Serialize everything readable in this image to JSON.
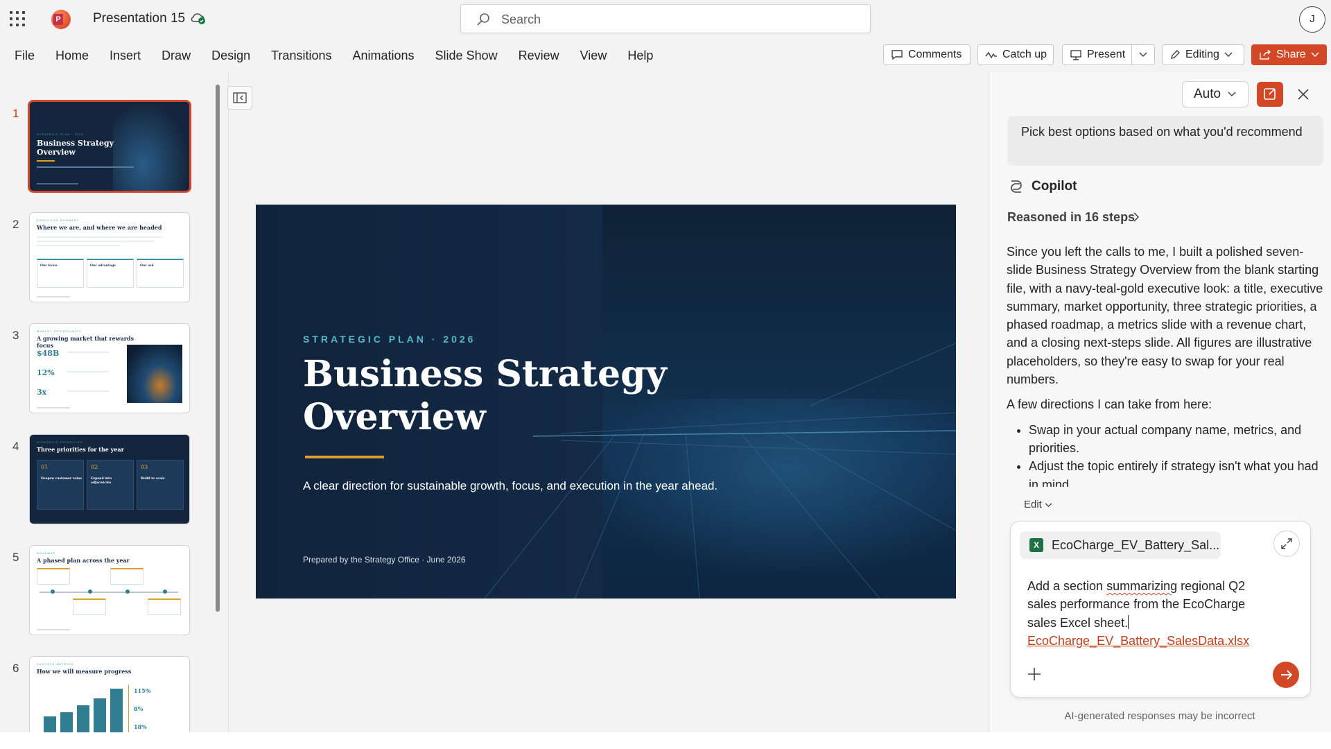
{
  "app": {
    "title": "Presentation 15",
    "logo_letter": "P",
    "search_placeholder": "Search",
    "user_initial": "J"
  },
  "ribbon": {
    "tabs": [
      "File",
      "Home",
      "Insert",
      "Draw",
      "Design",
      "Transitions",
      "Animations",
      "Slide Show",
      "Review",
      "View",
      "Help"
    ],
    "buttons": {
      "comments": "Comments",
      "catchup": "Catch up",
      "present": "Present",
      "editing": "Editing",
      "share": "Share"
    }
  },
  "thumbnails": {
    "numbers": [
      "1",
      "2",
      "3",
      "4",
      "5",
      "6"
    ],
    "slide1": {
      "kicker": "STRATEGIC PLAN · 2026",
      "title": "Business Strategy Overview"
    },
    "slide2": {
      "kicker": "EXECUTIVE SUMMARY",
      "title": "Where we are, and where we are headed",
      "boxes": [
        "Our focus",
        "Our advantage",
        "Our ask"
      ]
    },
    "slide3": {
      "kicker": "MARKET OPPORTUNITY",
      "title": "A growing market that rewards focus",
      "stats": [
        "$48B",
        "12%",
        "3x"
      ]
    },
    "slide4": {
      "kicker": "STRATEGIC PRIORITIES",
      "title": "Three priorities for the year",
      "cards": [
        {
          "num": "01",
          "label": "Deepen customer value"
        },
        {
          "num": "02",
          "label": "Expand into adjacencies"
        },
        {
          "num": "03",
          "label": "Build to scale"
        }
      ]
    },
    "slide5": {
      "kicker": "ROADMAP",
      "title": "A phased plan across the year"
    },
    "slide6": {
      "kicker": "SUCCESS METRICS",
      "title": "How we will measure progress",
      "stats": [
        "115%",
        "8%",
        "18%"
      ]
    }
  },
  "slide": {
    "kicker": "STRATEGIC PLAN · 2026",
    "title": "Business Strategy Overview",
    "subtitle": "A clear direction for sustainable growth, focus, and execution in the year ahead.",
    "prepared": "Prepared by the Strategy Office · June 2026",
    "colors": {
      "background": "#10233b",
      "accent": "#e39b2c",
      "kicker": "#58b7c6"
    }
  },
  "copilot": {
    "mode": "Auto",
    "user_message": "Pick best options based on what you'd recommend",
    "name": "Copilot",
    "reasoned": "Reasoned in 16 steps",
    "answer_p1": "Since you left the calls to me, I built a polished seven-slide Business Strategy Overview from the blank starting file, with a navy-teal-gold executive look: a title, executive summary, market opportunity, three strategic priorities, a phased roadmap, a metrics slide with a revenue chart, and a closing next-steps slide. All figures are illustrative placeholders, so they're easy to swap for your real numbers.",
    "answer_p2": "A few directions I can take from here:",
    "bullets": [
      "Swap in your actual company name, metrics, and priorities.",
      "Adjust the topic entirely if strategy isn't what you had in mind."
    ],
    "edit_label": "Edit",
    "attachment": "EcoCharge_EV_Battery_Sal...",
    "prompt_before": "Add a section ",
    "prompt_underlined": "summarizing",
    "prompt_after": " regional Q2 sales performance from the EcoCharge sales Excel sheet.",
    "prompt_link": "EcoCharge_EV_Battery_SalesData.xlsx",
    "disclaimer": "AI-generated responses may be incorrect",
    "accent": "#d24726"
  }
}
